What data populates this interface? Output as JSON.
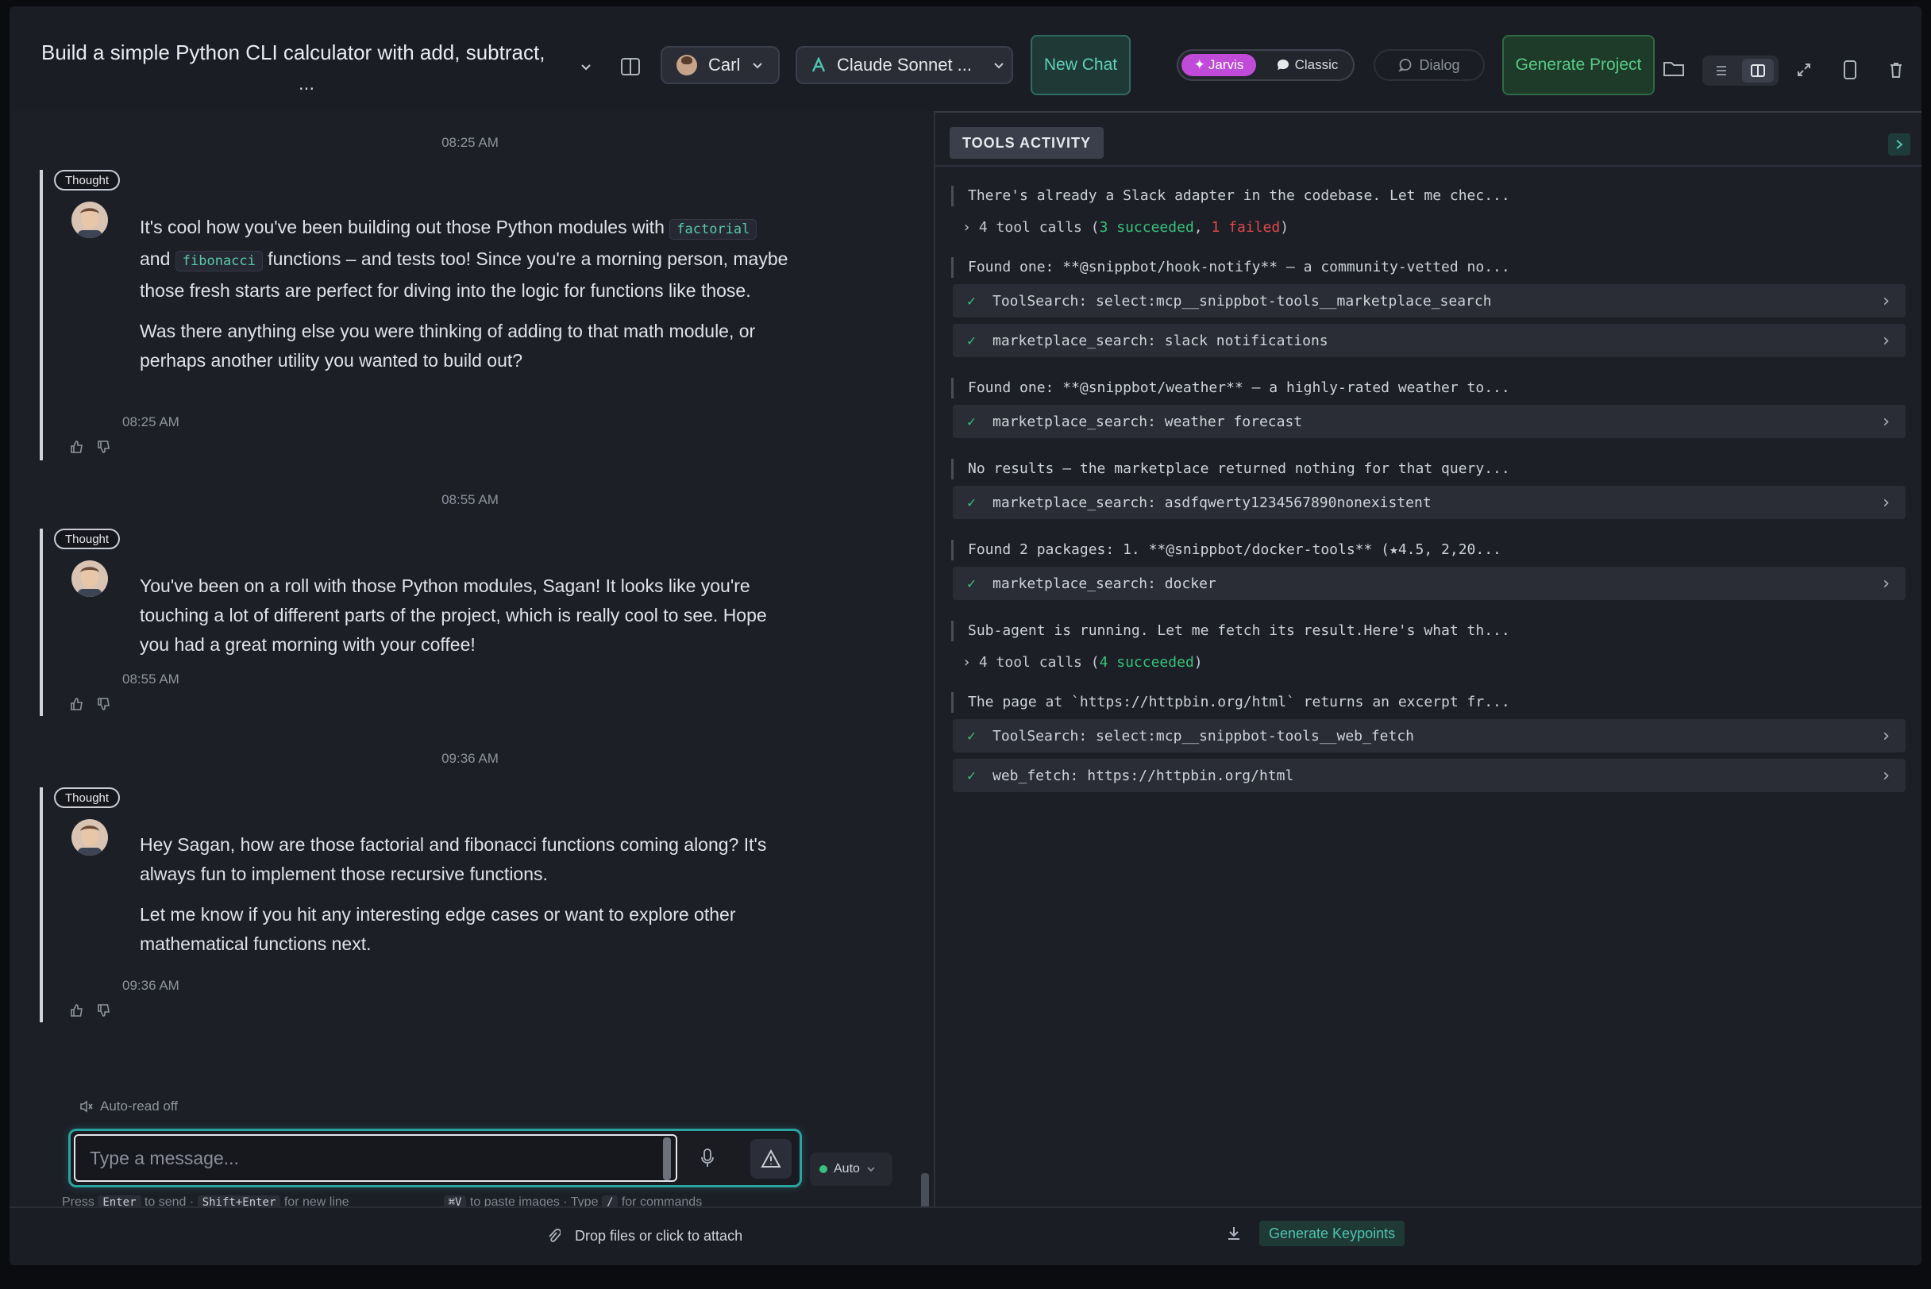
{
  "header": {
    "title": "Build a simple Python CLI calculator with add, subtract,",
    "title_ellipsis": "...",
    "user_label": "Carl",
    "model_label": "Claude Sonnet ...",
    "new_chat_label": "New Chat",
    "mode_jarvis": "Jarvis",
    "mode_classic": "Classic",
    "dialog_label": "Dialog",
    "generate_project_label": "Generate Project"
  },
  "chat": {
    "messages": [
      {
        "timestamp_header": "08:25 AM",
        "badge": "Thought",
        "paragraphs": {
          "p1_before": "It's cool how you've been building out those Python modules with",
          "code1": "factorial",
          "and": "and",
          "code2": "fibonacci",
          "p1_after": "functions – and tests too! Since you're a morning person, maybe those fresh starts are perfect for diving into the logic for functions like those.",
          "p2": "Was there anything else you were thinking of adding to that math module, or perhaps another utility you wanted to build out?"
        },
        "time": "08:25 AM"
      },
      {
        "timestamp_header": "08:55 AM",
        "badge": "Thought",
        "p1": "You've been on a roll with those Python modules, Sagan! It looks like you're touching a lot of different parts of the project, which is really cool to see. Hope you had a great morning with your coffee!",
        "time": "08:55 AM"
      },
      {
        "timestamp_header": "09:36 AM",
        "badge": "Thought",
        "p1": "Hey Sagan, how are those factorial and fibonacci functions coming along? It's always fun to implement those recursive functions.",
        "p2": "Let me know if you hit any interesting edge cases or want to explore other mathematical functions next.",
        "time": "09:36 AM"
      }
    ],
    "auto_read": "Auto-read off",
    "input_placeholder": "Type a message...",
    "auto_mode": "Auto",
    "hint": {
      "press": "Press",
      "enter": "Enter",
      "to_send": "to send ·",
      "shift_enter": "Shift+Enter",
      "new_line": "for new line",
      "paste_key": "⌘V",
      "paste": "to paste images · Type",
      "slash": "/",
      "commands": "for commands"
    }
  },
  "tools": {
    "title": "TOOLS ACTIVITY",
    "entries": [
      {
        "type": "msg",
        "text": "There's already a Slack adapter in the codebase. Let me chec..."
      },
      {
        "type": "summary",
        "count": "4 tool calls",
        "succeeded": "3 succeeded",
        "failed": "1 failed"
      },
      {
        "type": "msg",
        "text": "Found one: **@snippbot/hook-notify** — a community-vetted no..."
      },
      {
        "type": "call",
        "text": "ToolSearch: select:mcp__snippbot-tools__marketplace_search"
      },
      {
        "type": "call",
        "text": "marketplace_search: slack notifications"
      },
      {
        "type": "msg",
        "text": "Found one: **@snippbot/weather** — a highly-rated weather to..."
      },
      {
        "type": "call",
        "text": "marketplace_search: weather forecast"
      },
      {
        "type": "msg",
        "text": "No results — the marketplace returned nothing for that query..."
      },
      {
        "type": "call",
        "text": "marketplace_search: asdfqwerty1234567890nonexistent"
      },
      {
        "type": "msg",
        "text": "Found 2 packages: 1. **@snippbot/docker-tools** (★4.5, 2,20..."
      },
      {
        "type": "call",
        "text": "marketplace_search: docker"
      },
      {
        "type": "msg",
        "text": "Sub-agent is running. Let me fetch its result.Here's what th..."
      },
      {
        "type": "summary",
        "count": "4 tool calls",
        "succeeded": "4 succeeded"
      },
      {
        "type": "msg",
        "text": "The page at `https://httpbin.org/html` returns an excerpt fr..."
      },
      {
        "type": "call",
        "text": "ToolSearch: select:mcp__snippbot-tools__web_fetch"
      },
      {
        "type": "call",
        "text": "web_fetch: https://httpbin.org/html"
      }
    ]
  },
  "footer": {
    "attach": "Drop files or click to attach",
    "generate_keypoints": "Generate Keypoints"
  },
  "colors": {
    "accent_teal": "#2ba3a0",
    "jarvis_purple": "#c04bd8",
    "success": "#36c27a",
    "failure": "#e04848"
  }
}
